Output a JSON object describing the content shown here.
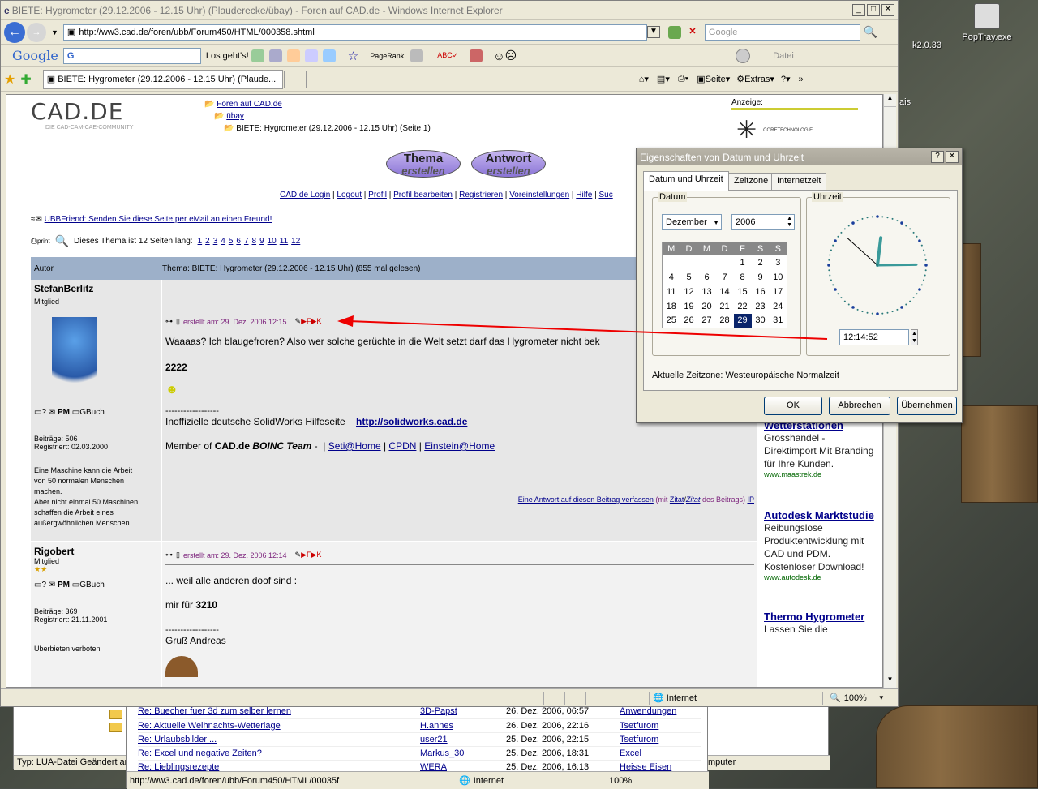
{
  "window": {
    "title": "BIETE: Hygrometer (29.12.2006 - 12.15 Uhr) (Plauderecke/übay) - Foren auf CAD.de - Windows Internet Explorer",
    "url": "http://ww3.cad.de/foren/ubb/Forum450/HTML/000358.shtml",
    "search_placeholder": "Google",
    "tab_label": "BIETE: Hygrometer (29.12.2006 - 12.15 Uhr) (Plaude...",
    "google_label": "Google",
    "losgehts": "Los geht's!",
    "pagerank": "PageRank",
    "datei": "Datei",
    "seite": "Seite",
    "extras": "Extras"
  },
  "desktop": {
    "icon1": "k2.0.33",
    "icon2": "PopTray.exe",
    "icon3": "nais"
  },
  "page": {
    "logo": "CAD.DE",
    "logo_sub": "DIE CAD-CAM-CAE-COMMUNITY",
    "breadcrumb": [
      "Foren auf CAD.de",
      "übay",
      "BIETE: Hygrometer (29.12.2006 - 12.15 Uhr) (Seite 1)"
    ],
    "btn1": [
      "Thema",
      "erstellen"
    ],
    "btn2": [
      "Antwort",
      "erstellen"
    ],
    "nav": [
      "CAD.de Login",
      "Logout",
      "Profil",
      "Profil bearbeiten",
      "Registrieren",
      "Voreinstellungen",
      "Hilfe",
      "Suc"
    ],
    "ubbfriend": "UBBFriend: Senden Sie diese Seite per eMail an einen Freund!",
    "print": "print",
    "pages_label": "Dieses Thema ist 12 Seiten lang:",
    "pages": [
      "1",
      "2",
      "3",
      "4",
      "5",
      "6",
      "7",
      "8",
      "9",
      "10",
      "11",
      "12"
    ],
    "col_author": "Autor",
    "col_topic": "Thema:   BIETE: Hygrometer (29.12.2006 - 12.15 Uhr) (855 mal gelesen)",
    "anzeige": "Anzeige:",
    "post1": {
      "user": "StefanBerlitz",
      "rank": "Mitglied",
      "pm": "PM",
      "gbuch": "GBuch",
      "beitraege": "Beiträge: 506",
      "registriert": "Registriert: 02.03.2000",
      "sig": [
        "Eine Maschine kann die Arbeit",
        "von 50 normalen Menschen",
        "machen.",
        "Aber nicht einmal 50 Maschinen",
        "schaffen die Arbeit eines",
        "außergwöhnlichen Menschen."
      ],
      "date": "erstellt am: 29. Dez. 2006 12:15",
      "text": "Waaaas? Ich blaugefroren? Also wer solche gerüchte in die Welt setzt darf das Hygrometer nicht bek",
      "num": "2222",
      "dashes": "------------------",
      "hilfe": "Inoffizielle deutsche SolidWorks Hilfeseite",
      "hilfe_link": "http://solidworks.cad.de",
      "member": "Member of",
      "cadde": "CAD.de",
      "boinc": "BOINC Team",
      "seti": "Seti@Home",
      "cpdn": "CPDN",
      "einstein": "Einstein@Home",
      "reply": "Eine Antwort auf diesen Beitrag verfassen",
      "reply2": "(mit",
      "zitat": "Zitat",
      "reply3": "des Beitrags)",
      "ip": "IP"
    },
    "post2": {
      "user": "Rigobert",
      "rank": "Mitglied",
      "stars": "★★",
      "pm": "PM",
      "gbuch": "GBuch",
      "beitraege": "Beiträge: 369",
      "registriert": "Registriert: 21.11.2001",
      "sig": "Überbieten verboten",
      "date": "erstellt am: 29. Dez. 2006 12:14",
      "text": "... weil alle anderen doof sind :",
      "mir": "mir für",
      "num": "3210",
      "dashes": "------------------",
      "gruss": "Gruß Andreas"
    },
    "ads": [
      {
        "title": "Wetterstationen",
        "text": "Grosshandel - Direktimport Mit Branding für Ihre Kunden.",
        "url": "www.maastrek.de"
      },
      {
        "title": "Autodesk Marktstudie",
        "text": "Reibungslose Produktentwicklung mit CAD und PDM. Kostenloser Download!",
        "url": "www.autodesk.de"
      },
      {
        "title": "Thermo Hygrometer",
        "text": "Lassen Sie die",
        "url": ""
      }
    ],
    "ad_brand": "CORETECHNOLOGIE"
  },
  "status": {
    "zone": "Internet",
    "zoom": "100%"
  },
  "dialog": {
    "title": "Eigenschaften von Datum und Uhrzeit",
    "tabs": [
      "Datum und Uhrzeit",
      "Zeitzone",
      "Internetzeit"
    ],
    "datum": "Datum",
    "uhrzeit": "Uhrzeit",
    "month": "Dezember",
    "year": "2006",
    "days_header": [
      "M",
      "D",
      "M",
      "D",
      "F",
      "S",
      "S"
    ],
    "weeks": [
      [
        "",
        "",
        "",
        "",
        "1",
        "2",
        "3"
      ],
      [
        "4",
        "5",
        "6",
        "7",
        "8",
        "9",
        "10"
      ],
      [
        "11",
        "12",
        "13",
        "14",
        "15",
        "16",
        "17"
      ],
      [
        "18",
        "19",
        "20",
        "21",
        "22",
        "23",
        "24"
      ],
      [
        "25",
        "26",
        "27",
        "28",
        "29",
        "30",
        "31"
      ]
    ],
    "selected_day": "29",
    "time": "12:14:52",
    "zone_text": "Aktuelle Zeitzone: Westeuropäische Normalzeit",
    "ok": "OK",
    "cancel": "Abbrechen",
    "apply": "Übernehmen"
  },
  "back_window": {
    "rows": [
      [
        "Re: Buecher fuer 3d zum selber lernen",
        "3D-Papst",
        "26. Dez. 2006, 06:57",
        "Anwendungen"
      ],
      [
        "Re: Aktuelle Weihnachts-Wetterlage",
        "H.annes",
        "26. Dez. 2006, 22:16",
        "Tsetfurom"
      ],
      [
        "Re: Urlaubsbilder ...",
        "user21",
        "25. Dez. 2006, 22:15",
        "Tsetfurom"
      ],
      [
        "Re: Excel und negative Zeiten?",
        "Markus_30",
        "25. Dez. 2006, 18:31",
        "Excel"
      ],
      [
        "Re: Lieblingsrezepte",
        "WERA",
        "25. Dez. 2006, 16:13",
        "Heisse Eisen"
      ]
    ],
    "explorer_status": "Typ: LUA-Datei Geändert ar",
    "computer": "mputer",
    "status_url": "http://ww3.cad.de/foren/ubb/Forum450/HTML/00035f",
    "status_zone": "Internet",
    "status_zoom": "100%"
  }
}
